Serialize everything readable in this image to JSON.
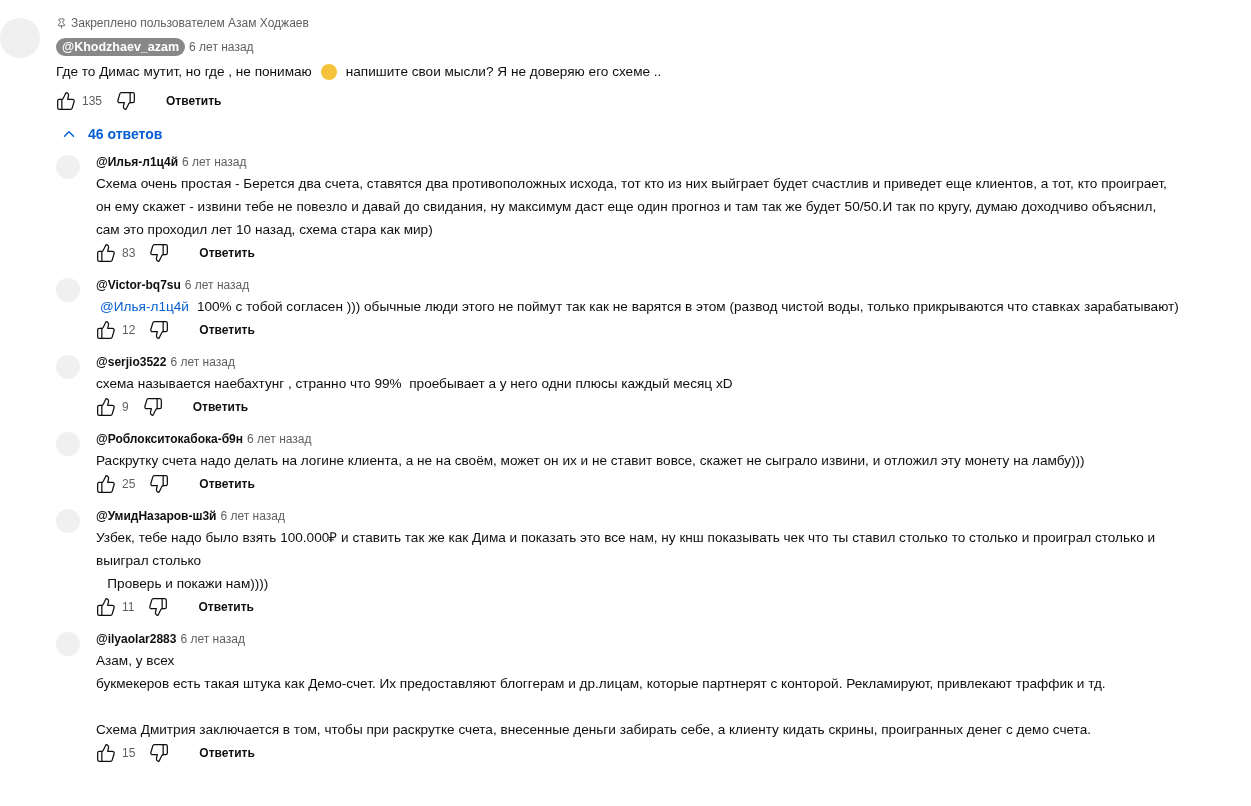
{
  "pinned_comment": {
    "pinned_label": "Закреплено пользователем Азам Ходжаев",
    "author": "@Khodzhaev_azam",
    "time": "6 лет назад",
    "text_before_emoji": "Где то Димас мутит, но где , не понимаю",
    "text_after_emoji": "напишите свои мысли? Я не доверяю его схеме ..",
    "likes": "135",
    "reply_label": "Ответить"
  },
  "replies_toggle": {
    "label": "46 ответов",
    "expanded": true
  },
  "replies": [
    {
      "author": "@Илья-л1ц4й",
      "time": "6 лет назад",
      "text": "Схема очень простая - Берется два счета, ставятся два противоположных исхода, тот кто из них выйграет будет счастлив и приведет еще клиентов, а тот, кто проиграет,\nон ему скажет - извини тебе не повезло и давай до свидания, ну максимум даст еще один прогноз и там так же будет 50/50.И так по кругу, думаю доходчиво объяснил,\nсам это проходил лет 10 назад, схема стара как мир)",
      "likes": "83",
      "reply_label": "Ответить"
    },
    {
      "author": "@Victor-bq7su",
      "time": "6 лет назад",
      "mention": "@Илья-л1ц4й",
      "text": "100% с тобой согласен ))) обычные люди этого не поймут так как не варятся в этом (развод чистой воды, только прикрываются что ставках зарабатывают)",
      "likes": "12",
      "reply_label": "Ответить"
    },
    {
      "author": "@serjio3522",
      "time": "6 лет назад",
      "text": "схема называется наебахтунг , странно что 99%  проебывает а у него одни плюсы каждый месяц xD",
      "likes": "9",
      "reply_label": "Ответить"
    },
    {
      "author": "@Роблокситокабока-б9н",
      "time": "6 лет назад",
      "text": "Раскрутку счета надо делать на логине клиента, а не на своём, может он их и не ставит вовсе, скажет не сыграло извини, и отложил эту монету на ламбу)))",
      "likes": "25",
      "reply_label": "Ответить"
    },
    {
      "author": "@УмидНазаров-ш3й",
      "time": "6 лет назад",
      "text": "Узбек, тебе надо было взять 100.000₽ и ставить так же как Дима и показать это все нам, ну кнш показывать чек что ты ставил столько то столько и проиграл столько и\nвыиграл столько\n   Проверь и покажи нам))))",
      "likes": "11",
      "reply_label": "Ответить"
    },
    {
      "author": "@ilyaolar2883",
      "time": "6 лет назад",
      "text": "Азам, у всех\nбукмекеров есть такая штука как Демо-счет. Их предоставляют блоггерам и др.лицам, которые партнерят с конторой. Рекламируют, привлекают траффик и тд.\n\nСхема Дмитрия заключается в том, чтобы при раскрутке счета, внесенные деньги забирать себе, а клиенту кидать скрины, проигранных денег с демо счета.",
      "likes": "15",
      "reply_label": "Ответить"
    }
  ]
}
